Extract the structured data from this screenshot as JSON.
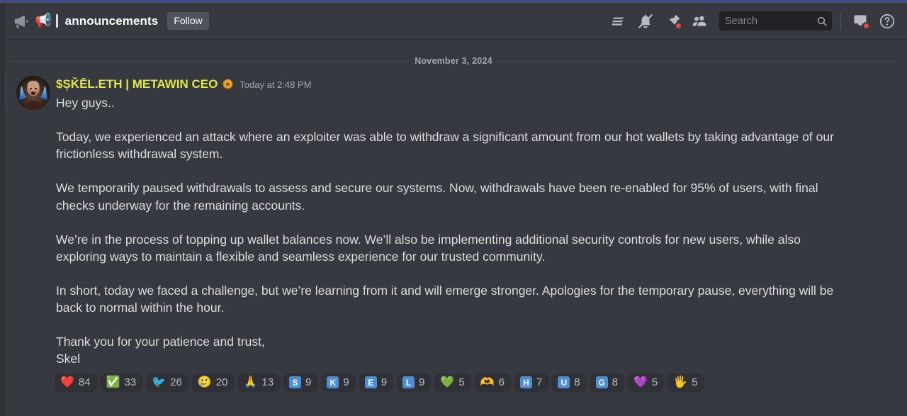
{
  "theme": {
    "accent_top": "#454b8a",
    "app_bg": "#36393f",
    "sidebar_bg": "#2f3136",
    "username_color": "#e3e83c",
    "text_color": "#dcddde",
    "muted_color": "#a3a6aa",
    "badge_red": "#ed4245",
    "reaction_bg": "#2f3136"
  },
  "header": {
    "channel_icon": "announcement-channel-icon",
    "channel_emoji": "📢",
    "channel_name": "announcements",
    "follow_label": "Follow",
    "icons": [
      {
        "name": "threads-icon",
        "has_dot": false
      },
      {
        "name": "notifications-muted-icon",
        "has_dot": false
      },
      {
        "name": "pinned-messages-icon",
        "has_dot": true
      },
      {
        "name": "member-list-icon",
        "has_dot": false
      }
    ],
    "search": {
      "placeholder": "Search",
      "value": "",
      "icon": "search-icon"
    },
    "right_icons": [
      {
        "name": "inbox-icon",
        "has_dot": true
      },
      {
        "name": "help-icon",
        "has_dot": false
      }
    ]
  },
  "chat": {
    "date_divider": "November 3, 2024",
    "message": {
      "author": "$ȘǨĒL.ETH | METAWIN CEO",
      "author_badge": "server-owner-badge-icon",
      "avatar": "user-avatar",
      "timestamp": "Today at 2:48 PM",
      "paragraphs": [
        "Hey guys..",
        "Today, we experienced an attack where an exploiter was able to withdraw a significant amount from our hot wallets by taking advantage of our frictionless withdrawal system.",
        "We temporarily paused withdrawals to assess and secure our systems. Now, withdrawals have been re-enabled for 95% of users, with final checks underway for the remaining accounts.",
        "We’re in the process of topping up wallet balances now. We’ll also be implementing additional security controls for new users, while also exploring ways to maintain a flexible and seamless experience for our trusted community.",
        "In short, today we faced a challenge, but we’re learning from it and will emerge stronger. Apologies for the temporary pause, everything will be back to normal within the hour.",
        "Thank you for your patience and trust,",
        "Skel"
      ],
      "reactions": [
        {
          "name": "red-heart",
          "emoji": "❤️",
          "type": "emoji",
          "count": "84"
        },
        {
          "name": "white-check-mark",
          "emoji": "✅",
          "type": "emoji",
          "count": "33"
        },
        {
          "name": "blue-custom-emoji",
          "emoji": "🐦",
          "type": "emoji",
          "count": "26"
        },
        {
          "name": "smiling-face-with-tear",
          "emoji": "🥲",
          "type": "emoji",
          "count": "20"
        },
        {
          "name": "folded-hands",
          "emoji": "🙏",
          "type": "emoji",
          "count": "13"
        },
        {
          "name": "regional-indicator-s",
          "emoji": "S",
          "type": "letter",
          "count": "9"
        },
        {
          "name": "regional-indicator-k",
          "emoji": "K",
          "type": "letter",
          "count": "9"
        },
        {
          "name": "regional-indicator-e",
          "emoji": "E",
          "type": "letter",
          "count": "9"
        },
        {
          "name": "regional-indicator-l",
          "emoji": "L",
          "type": "letter",
          "count": "9"
        },
        {
          "name": "green-heart",
          "emoji": "💚",
          "type": "emoji",
          "count": "5"
        },
        {
          "name": "heart-hands",
          "emoji": "🫶",
          "type": "emoji",
          "count": "6"
        },
        {
          "name": "regional-indicator-h",
          "emoji": "H",
          "type": "letter",
          "count": "7"
        },
        {
          "name": "regional-indicator-u",
          "emoji": "U",
          "type": "letter",
          "count": "8"
        },
        {
          "name": "regional-indicator-g",
          "emoji": "G",
          "type": "letter",
          "count": "8"
        },
        {
          "name": "purple-heart",
          "emoji": "💜",
          "type": "emoji",
          "count": "5"
        },
        {
          "name": "raised-hand-high-five",
          "emoji": "🖐️",
          "type": "emoji",
          "count": "5"
        }
      ]
    }
  }
}
